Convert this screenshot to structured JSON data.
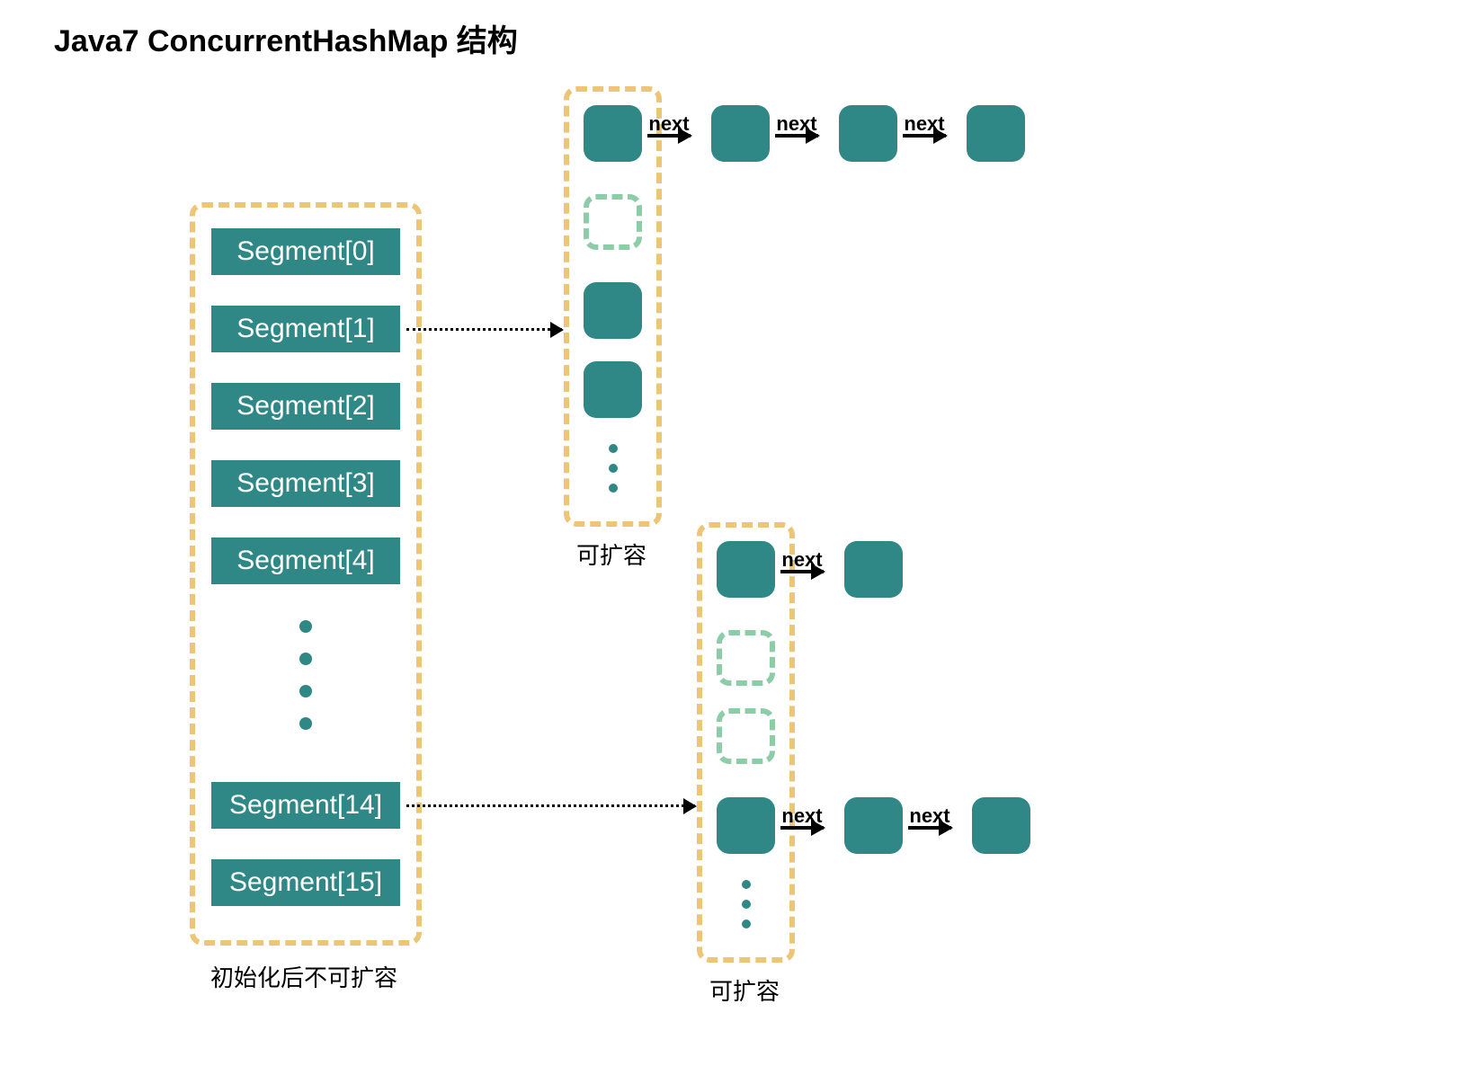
{
  "title": "Java7 ConcurrentHashMap 结构",
  "segments": {
    "s0": "Segment[0]",
    "s1": "Segment[1]",
    "s2": "Segment[2]",
    "s3": "Segment[3]",
    "s4": "Segment[4]",
    "s14": "Segment[14]",
    "s15": "Segment[15]"
  },
  "labels": {
    "next": "next",
    "segment_caption": "初始化后不可扩容",
    "bucket_caption": "可扩容"
  },
  "colors": {
    "teal": "#2F8885",
    "dash_orange": "#ECC676",
    "dash_green": "#8CCDA8"
  }
}
